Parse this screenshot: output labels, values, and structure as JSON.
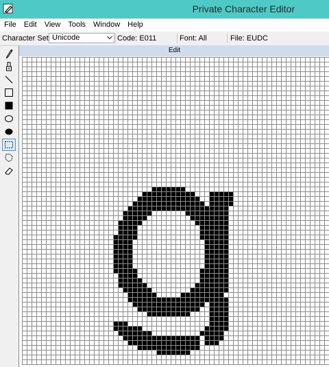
{
  "window": {
    "title": "Private Character Editor"
  },
  "menu": [
    "File",
    "Edit",
    "View",
    "Tools",
    "Window",
    "Help"
  ],
  "infobar": {
    "charset_label": "Character Set:",
    "charset_value": "Unicode",
    "code": "Code: E011",
    "font": "Font: All",
    "file": "File: EUDC"
  },
  "tools": [
    {
      "name": "pencil-icon",
      "selected": false
    },
    {
      "name": "brush-icon",
      "selected": false
    },
    {
      "name": "line-icon",
      "selected": false
    },
    {
      "name": "hollow-rectangle-icon",
      "selected": false
    },
    {
      "name": "filled-rectangle-icon",
      "selected": false
    },
    {
      "name": "hollow-ellipse-icon",
      "selected": false
    },
    {
      "name": "filled-ellipse-icon",
      "selected": false
    },
    {
      "name": "rectangular-selection-icon",
      "selected": true
    },
    {
      "name": "freeform-selection-icon",
      "selected": false
    },
    {
      "name": "eraser-icon",
      "selected": false
    }
  ],
  "editor": {
    "title": "Edit",
    "grid_size": 64,
    "colors": {
      "on": "#000000",
      "off": "#ffffff",
      "grid": "#8c8c8c"
    },
    "glyph_rows": [
      "................................................................",
      "................................................................",
      "................................................................",
      "................................................................",
      "................................................................",
      "................................................................",
      "................................................................",
      "................................................................",
      "................................................................",
      "................................................................",
      "................................................................",
      "................................................................",
      "................................................................",
      "................................................................",
      "................................................................",
      "................................................................",
      "................................................................",
      "................................................................",
      "................................................................",
      "................................................................",
      "................................................................",
      "................................................................",
      "................................................................",
      "................................................................",
      "................................................................",
      "................................................................",
      "................................................................",
      "...........................#######.............................",
      ".........................###########...#####...................",
      "........................#############..#####...................",
      ".......................###############.#####...................",
      "......................#####################....................",
      ".....................######.......#########....................",
      ".....................#####.........########....................",
      "....................#####...........#######....................",
      "....................####.............######....................",
      "....................####.............######....................",
      "...................#####.............######....................",
      "...................####...............#####....................",
      "...................####...............#####....................",
      "...................####...............#####....................",
      "...................####...............#####....................",
      "...................####...............#####....................",
      "...................####...............#####....................",
      "...................#####.............######....................",
      "....................####.............######....................",
      "....................#####............######....................",
      "....................######..........#######....................",
      ".....................######........########....................",
      "......................######.....#########.....................",
      "......................#####################....................",
      ".......................###############.####....................",
      "........................#############..####....................",
      "..........................#########....####....................",
      ".......................................####....................",
      "...................###.................####....................",
      "...................######.............#####....................",
      "....................#######..........#####.....................",
      ".....................################.####......................",
      "......................###############.###.......................",
      "........................#############...........................",
      "............................#######............................."
    ]
  }
}
